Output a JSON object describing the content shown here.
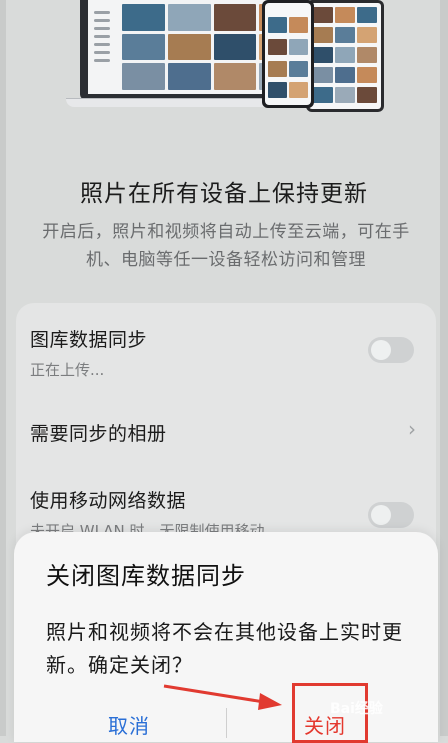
{
  "colors": {
    "accent": "#2a6fd6",
    "danger": "#e4382e",
    "annotation": "#e13a30"
  },
  "icons": {
    "chevron": "chevron-right-icon",
    "toggle": "toggle-off"
  },
  "hero": {
    "illustration": "devices-illustration"
  },
  "header": {
    "title": "照片在所有设备上保持更新",
    "description": "开启后，照片和视频将自动上传至云端，可在手机、电脑等任一设备轻松访问和管理"
  },
  "settings": {
    "gallery_sync": {
      "title": "图库数据同步",
      "subtitle": "正在上传...",
      "enabled": false
    },
    "albums_to_sync": {
      "title": "需要同步的相册",
      "chevron": "›"
    },
    "mobile_data": {
      "title": "使用移动网络数据",
      "subtitle": "未开启 WLAN 时，无限制使用移动",
      "enabled": false
    }
  },
  "dialog": {
    "title": "关闭图库数据同步",
    "message": "照片和视频将不会在其他设备上实时更新。确定关闭？",
    "cancel_label": "取消",
    "confirm_label": "关闭"
  },
  "watermark": {
    "text": "Bai经验"
  }
}
